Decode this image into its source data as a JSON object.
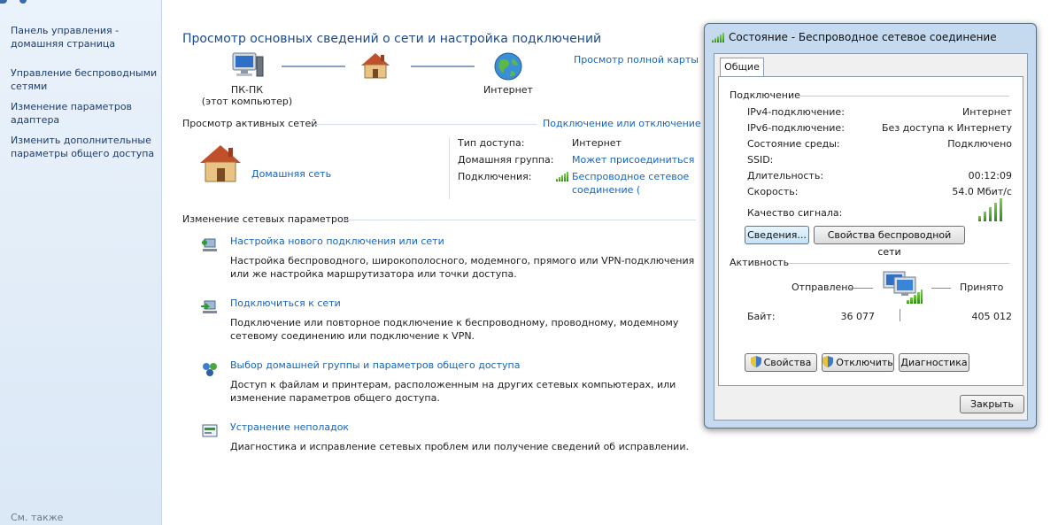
{
  "sidebar": {
    "home": "Панель управления -\nдомашняя страница",
    "wireless": "Управление беспроводными\nсетями",
    "adapter": "Изменение параметров\nадаптера",
    "sharing": "Изменить дополнительные\nпараметры общего доступа",
    "see_also": "См. также"
  },
  "main": {
    "title": "Просмотр основных сведений о сети и настройка подключений",
    "map_link": "Просмотр полной карты",
    "nodes": {
      "computer_name": "ПК-ПК",
      "computer_sub": "(этот компьютер)",
      "internet": "Интернет"
    },
    "active_networks": {
      "heading": "Просмотр активных сетей",
      "connect_link": "Подключение или отключение",
      "network_type": "Домашняя сеть",
      "access_type_label": "Тип доступа:",
      "access_type_value": "Интернет",
      "homegroup_label": "Домашняя группа:",
      "homegroup_value": "Может присоединиться",
      "connections_label": "Подключения:",
      "connections_value_1": "Беспроводное сетевое",
      "connections_value_2": "соединение ("
    },
    "change_settings": {
      "heading": "Изменение сетевых параметров",
      "tasks": [
        {
          "link": "Настройка нового подключения или сети",
          "desc": "Настройка беспроводного, широкополосного, модемного, прямого или VPN-подключения\nили же настройка маршрутизатора или точки доступа."
        },
        {
          "link": "Подключиться к сети",
          "desc": "Подключение или повторное подключение к беспроводному, проводному, модемному\nсетевому соединению или подключение к VPN."
        },
        {
          "link": "Выбор домашней группы и параметров общего доступа",
          "desc": "Доступ к файлам и принтерам, расположенным на других сетевых компьютерах, или\nизменение параметров общего доступа."
        },
        {
          "link": "Устранение неполадок",
          "desc": "Диагностика и исправление сетевых проблем или получение сведений об исправлении."
        }
      ]
    }
  },
  "dialog": {
    "title": "Состояние - Беспроводное сетевое соединение",
    "tab": "Общие",
    "connection_group": "Подключение",
    "rows": [
      {
        "label": "IPv4-подключение:",
        "value": "Интернет"
      },
      {
        "label": "IPv6-подключение:",
        "value": "Без доступа к Интернету"
      },
      {
        "label": "Состояние среды:",
        "value": "Подключено"
      },
      {
        "label": "SSID:",
        "value": ""
      },
      {
        "label": "Длительность:",
        "value": "00:12:09"
      },
      {
        "label": "Скорость:",
        "value": "54.0 Мбит/с"
      }
    ],
    "signal_label": "Качество сигнала:",
    "signal_level": 5,
    "details_button": "Сведения...",
    "wireless_props_button": "Свойства беспроводной сети",
    "activity_group": "Активность",
    "sent_label": "Отправлено",
    "received_label": "Принято",
    "bytes_label": "Байт:",
    "bytes_sent": "36 077",
    "bytes_received": "405 012",
    "properties_button": "Свойства",
    "disconnect_button": "Отключить",
    "diagnostics_button": "Диагностика",
    "close_button": "Закрыть"
  },
  "colors": {
    "link": "#1565c0",
    "title": "#1c4b8c",
    "sidebar_bg": "#dbe8f6",
    "signal_green": "#2f8a17"
  },
  "icons": [
    "computer-icon",
    "house-icon",
    "globe-icon",
    "new-connection-icon",
    "connect-icon",
    "homegroup-icon",
    "troubleshoot-icon",
    "shield-icon",
    "signal-bars-icon"
  ]
}
